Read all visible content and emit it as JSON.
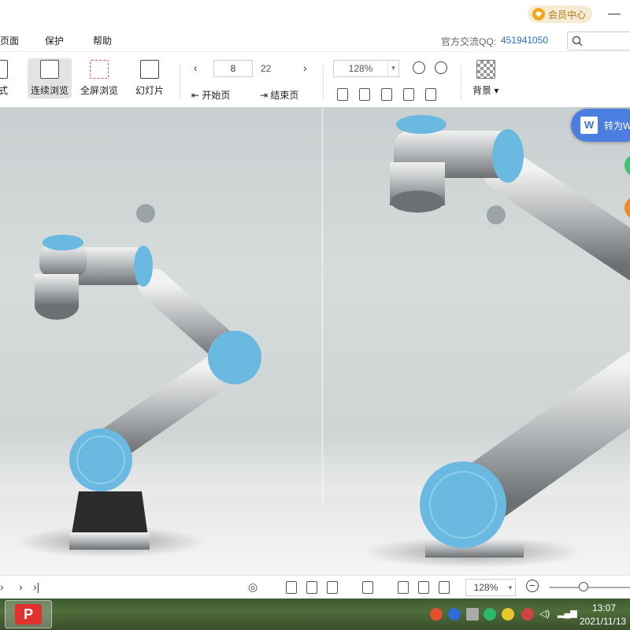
{
  "titlebar": {
    "vip_label": "会员中心",
    "minimize_label": "—"
  },
  "menubar": {
    "items": [
      "页面",
      "保护",
      "帮助"
    ],
    "qq_label": "官方交流QQ:",
    "qq_number": "451941050"
  },
  "toolbar": {
    "modes": [
      "模式",
      "连续浏览",
      "全屏浏览",
      "幻灯片"
    ],
    "page_current": "8",
    "page_total": "22",
    "first_page": "开始页",
    "last_page": "结束页",
    "zoom": "128%",
    "background": "背景"
  },
  "document": {
    "convert_label": "转为W"
  },
  "statusbar": {
    "zoom": "128%"
  },
  "taskbar": {
    "time": "13:07",
    "date": "2021/11/13"
  },
  "colors": {
    "accent": "#4c7ee0",
    "vip": "#f0a81a",
    "robot_blue": "#6ab9e0"
  }
}
